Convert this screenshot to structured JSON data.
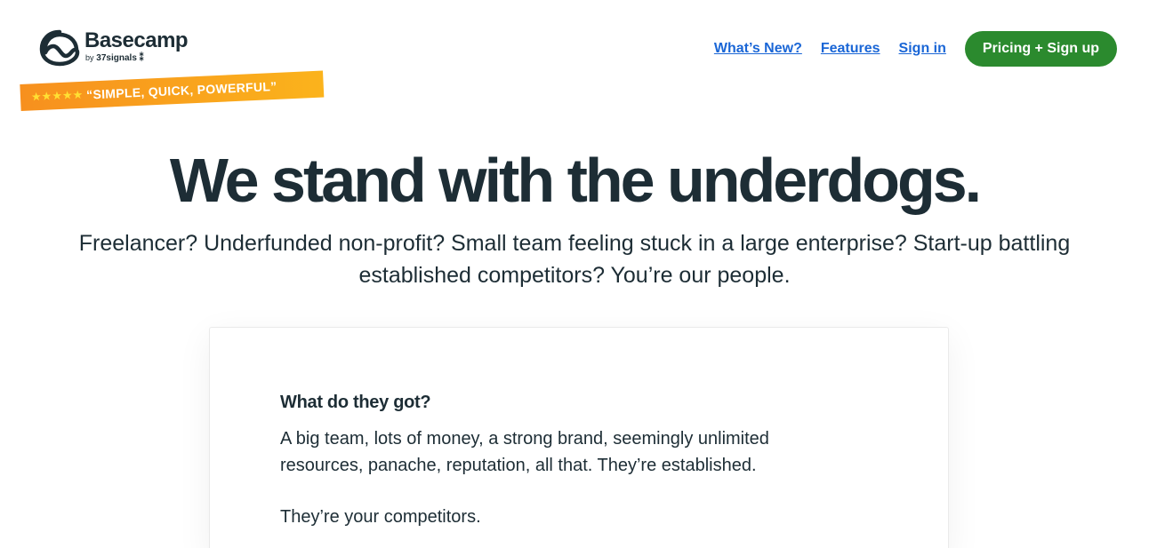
{
  "brand": {
    "name": "Basecamp",
    "by_prefix": "by",
    "by_company": "37signals",
    "icon": "basecamp-logo-icon"
  },
  "ribbon": {
    "stars": "★★★★★",
    "quote": "“SIMPLE, QUICK, POWERFUL”",
    "colors": {
      "start": "#f7901e",
      "end": "#fbb31c",
      "stars": "#ffe033"
    }
  },
  "nav": {
    "links": [
      "What’s New?",
      "Features",
      "Sign in"
    ],
    "cta": "Pricing + Sign up",
    "link_color": "#1a66d6",
    "cta_color": "#2b8a2e"
  },
  "hero": {
    "headline": "We stand with the underdogs.",
    "subhead_line1": "Freelancer? Underfunded non-profit? Small team feeling stuck in a large enterprise? Start-up battling",
    "subhead_line2": "established competitors? You’re our people."
  },
  "card": {
    "question": "What do they got?",
    "paragraph": "A big team, lots of money, a strong brand, seemingly unlimited resources, panache, reputation, all that. They’re established.",
    "paragraph2": "They’re your competitors."
  }
}
